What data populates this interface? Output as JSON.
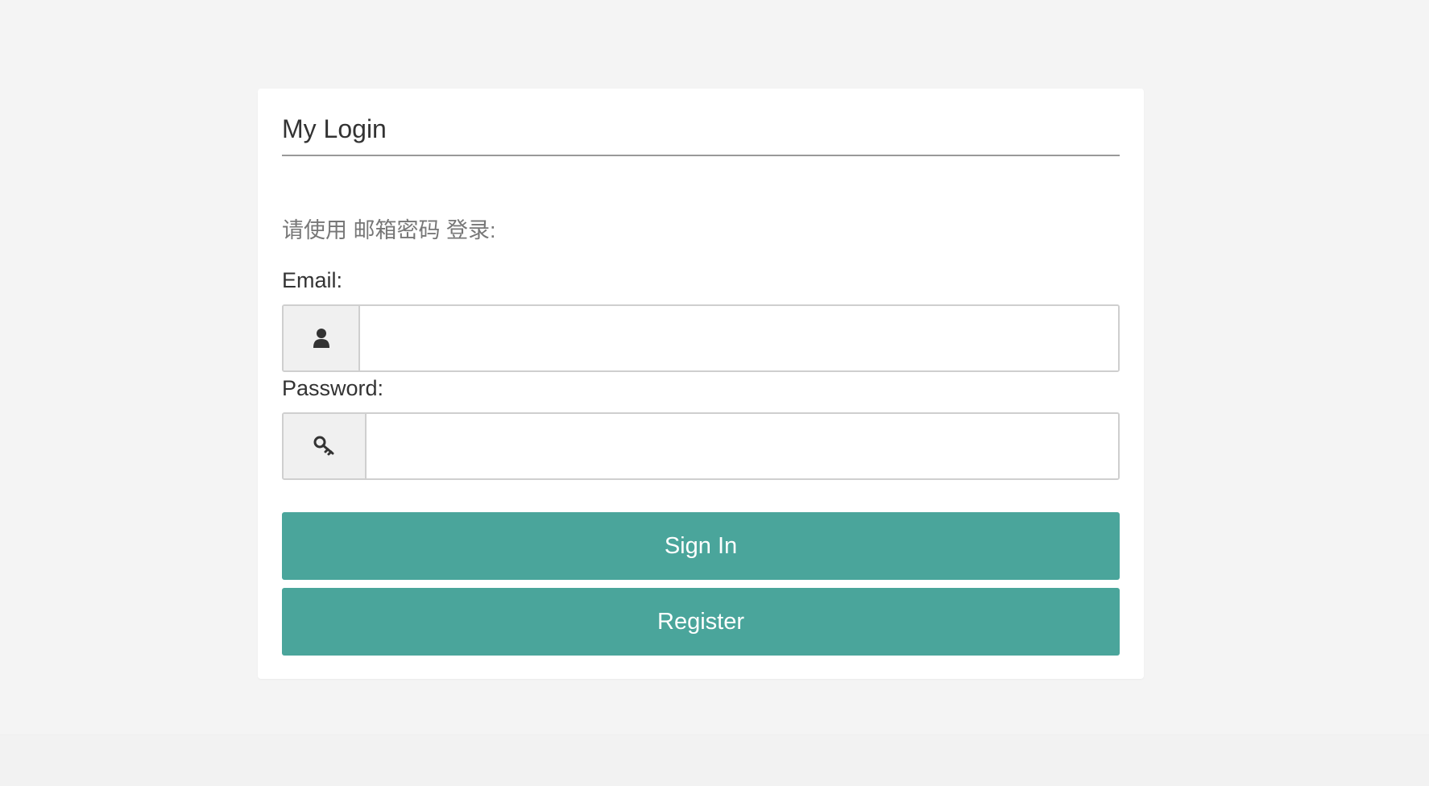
{
  "login": {
    "title": "My Login",
    "hint": "请使用 邮箱密码 登录:",
    "email": {
      "label": "Email:",
      "icon": "user-icon",
      "value": "",
      "placeholder": ""
    },
    "password": {
      "label": "Password:",
      "icon": "key-icon",
      "value": "",
      "placeholder": ""
    },
    "buttons": {
      "sign_in": "Sign In",
      "register": "Register"
    }
  },
  "colors": {
    "page_background": "#f4f4f4",
    "card_background": "#ffffff",
    "button": "#4aa59b",
    "button_text": "#ffffff",
    "addon_background": "#f0f0f0"
  }
}
